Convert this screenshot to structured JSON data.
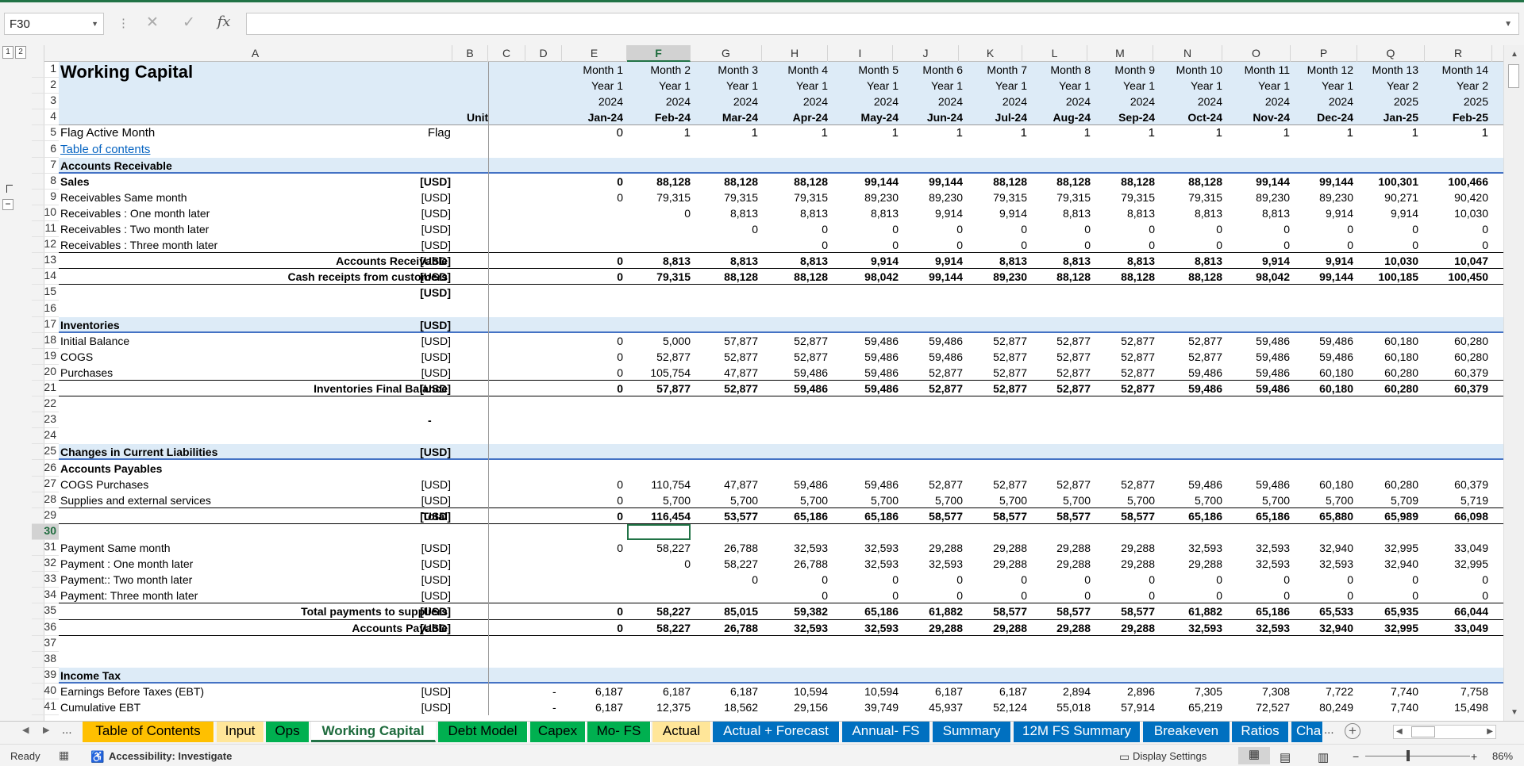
{
  "formula_bar": {
    "name_box": "F30",
    "formula": "",
    "cancel_icon": "✕",
    "enter_icon": "✓",
    "fx_label": "fx"
  },
  "outline_levels": [
    "1",
    "2"
  ],
  "columns": [
    "A",
    "B",
    "C",
    "D",
    "E",
    "F",
    "G",
    "H",
    "I",
    "J",
    "K",
    "L",
    "M",
    "N",
    "O",
    "P",
    "Q",
    "R"
  ],
  "selected_column": "F",
  "selected_row": 30,
  "months": {
    "label": [
      "Month 1",
      "Month 2",
      "Month 3",
      "Month 4",
      "Month 5",
      "Month 6",
      "Month 7",
      "Month 8",
      "Month 9",
      "Month 10",
      "Month 11",
      "Month 12",
      "Month 13",
      "Month 14"
    ],
    "year": [
      "Year 1",
      "Year 1",
      "Year 1",
      "Year 1",
      "Year 1",
      "Year 1",
      "Year 1",
      "Year 1",
      "Year 1",
      "Year 1",
      "Year 1",
      "Year 1",
      "Year 2",
      "Year 2"
    ],
    "cal_year": [
      "2024",
      "2024",
      "2024",
      "2024",
      "2024",
      "2024",
      "2024",
      "2024",
      "2024",
      "2024",
      "2024",
      "2024",
      "2025",
      "2025"
    ],
    "period": [
      "Jan-24",
      "Feb-24",
      "Mar-24",
      "Apr-24",
      "May-24",
      "Jun-24",
      "Jul-24",
      "Aug-24",
      "Sep-24",
      "Oct-24",
      "Nov-24",
      "Dec-24",
      "Jan-25",
      "Feb-25"
    ]
  },
  "sheet": {
    "title": "Working Capital",
    "unit_header": "Unit",
    "rows": [
      {
        "n": 5,
        "label": "Flag Active Month",
        "unit": "Flag",
        "vals": [
          "0",
          "1",
          "1",
          "1",
          "1",
          "1",
          "1",
          "1",
          "1",
          "1",
          "1",
          "1",
          "1",
          "1"
        ]
      },
      {
        "n": 6,
        "label": "Table of contents",
        "link": true
      },
      {
        "n": 7,
        "label": "Accounts Receivable",
        "bold": true,
        "band": true
      },
      {
        "n": 8,
        "label": "Sales",
        "bold": true,
        "unit": "[USD]",
        "vals": [
          "0",
          "88,128",
          "88,128",
          "88,128",
          "99,144",
          "99,144",
          "88,128",
          "88,128",
          "88,128",
          "88,128",
          "99,144",
          "99,144",
          "100,301",
          "100,466"
        ]
      },
      {
        "n": 9,
        "label": "Receivables Same month",
        "unit": "[USD]",
        "vals": [
          "0",
          "79,315",
          "79,315",
          "79,315",
          "89,230",
          "89,230",
          "79,315",
          "79,315",
          "79,315",
          "79,315",
          "89,230",
          "89,230",
          "90,271",
          "90,420"
        ]
      },
      {
        "n": 10,
        "label": "Receivables : One month later",
        "unit": "[USD]",
        "vals": [
          "",
          "0",
          "8,813",
          "8,813",
          "8,813",
          "9,914",
          "9,914",
          "8,813",
          "8,813",
          "8,813",
          "8,813",
          "9,914",
          "9,914",
          "10,030"
        ]
      },
      {
        "n": 11,
        "label": "Receivables : Two month later",
        "unit": "[USD]",
        "vals": [
          "",
          "",
          "0",
          "0",
          "0",
          "0",
          "0",
          "0",
          "0",
          "0",
          "0",
          "0",
          "0",
          "0"
        ]
      },
      {
        "n": 12,
        "label": "Receivables : Three month later",
        "unit": "[USD]",
        "vals": [
          "",
          "",
          "",
          "0",
          "0",
          "0",
          "0",
          "0",
          "0",
          "0",
          "0",
          "0",
          "0",
          "0"
        ]
      },
      {
        "n": 13,
        "label": "Accounts Receivable",
        "bold": true,
        "right": true,
        "unit": "[USD]",
        "vals": [
          "0",
          "8,813",
          "8,813",
          "8,813",
          "9,914",
          "9,914",
          "8,813",
          "8,813",
          "8,813",
          "8,813",
          "9,914",
          "9,914",
          "10,030",
          "10,047"
        ]
      },
      {
        "n": 14,
        "label": "Cash receipts from customers",
        "bold": true,
        "right": true,
        "unit": "[USD]",
        "vals": [
          "0",
          "79,315",
          "88,128",
          "88,128",
          "98,042",
          "99,144",
          "89,230",
          "88,128",
          "88,128",
          "88,128",
          "98,042",
          "99,144",
          "100,185",
          "100,450"
        ]
      },
      {
        "n": 15,
        "label": "",
        "bold": true,
        "unit": "[USD]"
      },
      {
        "n": 16,
        "label": ""
      },
      {
        "n": 17,
        "label": "Inventories",
        "bold": true,
        "band": true,
        "unit": "[USD]"
      },
      {
        "n": 18,
        "label": "Initial Balance",
        "unit": "[USD]",
        "vals": [
          "0",
          "5,000",
          "57,877",
          "52,877",
          "59,486",
          "59,486",
          "52,877",
          "52,877",
          "52,877",
          "52,877",
          "59,486",
          "59,486",
          "60,180",
          "60,280"
        ]
      },
      {
        "n": 19,
        "label": "COGS",
        "unit": "[USD]",
        "vals": [
          "0",
          "52,877",
          "52,877",
          "52,877",
          "59,486",
          "59,486",
          "52,877",
          "52,877",
          "52,877",
          "52,877",
          "59,486",
          "59,486",
          "60,180",
          "60,280"
        ]
      },
      {
        "n": 20,
        "label": "Purchases",
        "unit": "[USD]",
        "vals": [
          "0",
          "105,754",
          "47,877",
          "59,486",
          "59,486",
          "52,877",
          "52,877",
          "52,877",
          "52,877",
          "59,486",
          "59,486",
          "60,180",
          "60,280",
          "60,379"
        ]
      },
      {
        "n": 21,
        "label": "Inventories Final Balance",
        "bold": true,
        "right": true,
        "unit": "[USD]",
        "vals": [
          "0",
          "57,877",
          "52,877",
          "59,486",
          "59,486",
          "52,877",
          "52,877",
          "52,877",
          "52,877",
          "59,486",
          "59,486",
          "60,180",
          "60,280",
          "60,379"
        ]
      },
      {
        "n": 22,
        "label": ""
      },
      {
        "n": 23,
        "label": "",
        "dash": "-"
      },
      {
        "n": 24,
        "label": ""
      },
      {
        "n": 25,
        "label": "Changes in Current Liabilities",
        "bold": true,
        "band": true,
        "unit": "[USD]"
      },
      {
        "n": 26,
        "label": "Accounts Payables",
        "bold": true
      },
      {
        "n": 27,
        "label": "COGS Purchases",
        "unit": "[USD]",
        "vals": [
          "0",
          "110,754",
          "47,877",
          "59,486",
          "59,486",
          "52,877",
          "52,877",
          "52,877",
          "52,877",
          "59,486",
          "59,486",
          "60,180",
          "60,280",
          "60,379"
        ]
      },
      {
        "n": 28,
        "label": "Supplies and external services",
        "unit": "[USD]",
        "vals": [
          "0",
          "5,700",
          "5,700",
          "5,700",
          "5,700",
          "5,700",
          "5,700",
          "5,700",
          "5,700",
          "5,700",
          "5,700",
          "5,700",
          "5,709",
          "5,719"
        ]
      },
      {
        "n": 29,
        "label": "Total",
        "bold": true,
        "right": true,
        "unit": "[USD]",
        "vals": [
          "0",
          "116,454",
          "53,577",
          "65,186",
          "65,186",
          "58,577",
          "58,577",
          "58,577",
          "58,577",
          "65,186",
          "65,186",
          "65,880",
          "65,989",
          "66,098"
        ]
      },
      {
        "n": 30,
        "label": ""
      },
      {
        "n": 31,
        "label": "Payment Same month",
        "unit": "[USD]",
        "vals": [
          "0",
          "58,227",
          "26,788",
          "32,593",
          "32,593",
          "29,288",
          "29,288",
          "29,288",
          "29,288",
          "32,593",
          "32,593",
          "32,940",
          "32,995",
          "33,049"
        ]
      },
      {
        "n": 32,
        "label": "Payment : One month later",
        "unit": "[USD]",
        "vals": [
          "",
          "0",
          "58,227",
          "26,788",
          "32,593",
          "32,593",
          "29,288",
          "29,288",
          "29,288",
          "29,288",
          "32,593",
          "32,593",
          "32,940",
          "32,995"
        ]
      },
      {
        "n": 33,
        "label": "Payment:: Two month later",
        "unit": "[USD]",
        "vals": [
          "",
          "",
          "0",
          "0",
          "0",
          "0",
          "0",
          "0",
          "0",
          "0",
          "0",
          "0",
          "0",
          "0"
        ]
      },
      {
        "n": 34,
        "label": "Payment: Three month later",
        "unit": "[USD]",
        "vals": [
          "",
          "",
          "",
          "0",
          "0",
          "0",
          "0",
          "0",
          "0",
          "0",
          "0",
          "0",
          "0",
          "0"
        ]
      },
      {
        "n": 35,
        "label": "Total payments to suppliers",
        "bold": true,
        "right": true,
        "unit": "[USD]",
        "vals": [
          "0",
          "58,227",
          "85,015",
          "59,382",
          "65,186",
          "61,882",
          "58,577",
          "58,577",
          "58,577",
          "61,882",
          "65,186",
          "65,533",
          "65,935",
          "66,044"
        ]
      },
      {
        "n": 36,
        "label": "Accounts Payable",
        "bold": true,
        "right": true,
        "unit": "[USD]",
        "vals": [
          "0",
          "58,227",
          "26,788",
          "32,593",
          "32,593",
          "29,288",
          "29,288",
          "29,288",
          "29,288",
          "32,593",
          "32,593",
          "32,940",
          "32,995",
          "33,049"
        ]
      },
      {
        "n": 37,
        "label": ""
      },
      {
        "n": 38,
        "label": ""
      },
      {
        "n": 39,
        "label": "Income Tax",
        "bold": true,
        "band": true
      },
      {
        "n": 40,
        "label": "Earnings Before Taxes (EBT)",
        "unit": "[USD]",
        "d": "-",
        "vals": [
          "6,187",
          "6,187",
          "6,187",
          "10,594",
          "10,594",
          "6,187",
          "6,187",
          "2,894",
          "2,896",
          "7,305",
          "7,308",
          "7,722",
          "7,740",
          "7,758"
        ]
      },
      {
        "n": 41,
        "label": "Cumulative EBT",
        "unit": "[USD]",
        "d": "-",
        "vals": [
          "6,187",
          "12,375",
          "18,562",
          "29,156",
          "39,749",
          "45,937",
          "52,124",
          "55,018",
          "57,914",
          "65,219",
          "72,527",
          "80,249",
          "7,740",
          "15,498"
        ]
      }
    ]
  },
  "tabs": [
    {
      "label": "Table of Contents",
      "bg": "#ffc000",
      "color": "#000"
    },
    {
      "label": "Input",
      "bg": "#ffe699",
      "color": "#000"
    },
    {
      "label": "Ops",
      "bg": "#00b050",
      "color": "#000"
    },
    {
      "label": "Working Capital",
      "active": true
    },
    {
      "label": "Debt Model",
      "bg": "#00b050",
      "color": "#000"
    },
    {
      "label": "Capex",
      "bg": "#00b050",
      "color": "#000"
    },
    {
      "label": "Mo- FS",
      "bg": "#00b050",
      "color": "#000"
    },
    {
      "label": "Actual",
      "bg": "#ffe699",
      "color": "#000"
    },
    {
      "label": "Actual + Forecast",
      "bg": "#0070c0",
      "color": "#fff"
    },
    {
      "label": "Annual- FS",
      "bg": "#0070c0",
      "color": "#fff"
    },
    {
      "label": "Summary",
      "bg": "#0070c0",
      "color": "#fff"
    },
    {
      "label": "12M FS Summary",
      "bg": "#0070c0",
      "color": "#fff"
    },
    {
      "label": "Breakeven",
      "bg": "#0070c0",
      "color": "#fff"
    },
    {
      "label": "Ratios",
      "bg": "#0070c0",
      "color": "#fff"
    },
    {
      "label": "Cha",
      "bg": "#0070c0",
      "color": "#fff"
    }
  ],
  "tab_nav": {
    "prev": "◀",
    "next": "▶",
    "more": "...",
    "add": "+"
  },
  "status": {
    "ready": "Ready",
    "accessibility": "Accessibility: Investigate",
    "display_settings": "Display Settings",
    "zoom": "86%"
  }
}
